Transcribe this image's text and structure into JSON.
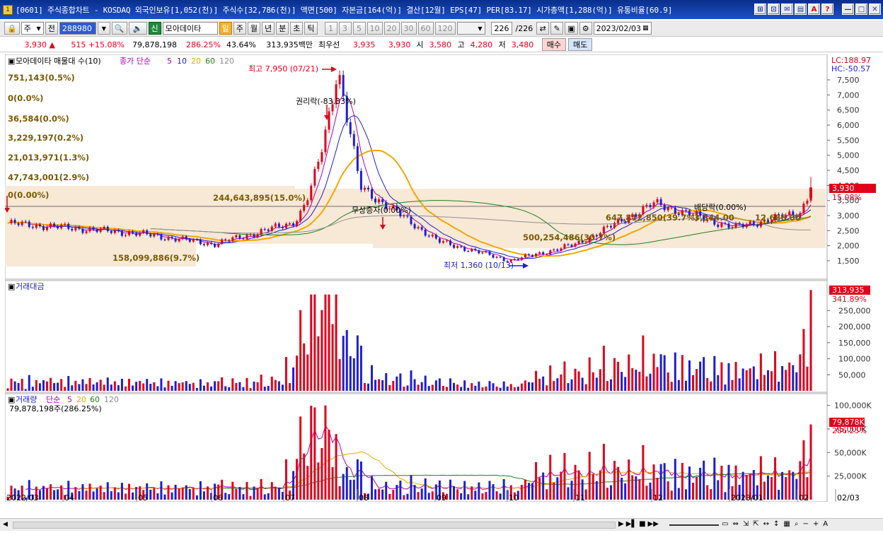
{
  "window": {
    "title": "[0601] 주식종합차트 - KOSDAQ 외국인보유[1,052(천)] 주식수[32,786(천)] 액면[500] 자본금[164(억)] 결산[12월] EPS[47] PER[83.17] 시가총액[1,288(억)] 유통비율[60.9]",
    "buttons": [
      "⊞",
      "⊡",
      "✉",
      "▤",
      "A",
      "?",
      "—",
      "□",
      "✕"
    ]
  },
  "toolbar": {
    "period_select": "주",
    "prev_label": "전",
    "code": "288980",
    "stock_name": "모아데이타",
    "badge_new": "신",
    "periods": [
      "일",
      "주",
      "월",
      "년",
      "분",
      "초",
      "틱"
    ],
    "selected_period": "일",
    "minutes": [
      "1",
      "3",
      "5",
      "10",
      "20",
      "30",
      "60",
      "120"
    ],
    "count": "226",
    "count_total": "/226",
    "date": "2023/02/03"
  },
  "price": {
    "current": "3,930",
    "arrow": "▲",
    "change": "515",
    "change_pct": "+15.08%",
    "volume": "79,878,198",
    "vol_ratio": "286.25%",
    "turnover": "43.64%",
    "trade_amount": "313,935백만",
    "best_ask_label": "최우선",
    "best_ask": "3,935",
    "best_bid": "3,930",
    "open_label": "시",
    "open": "3,580",
    "high_label": "고",
    "high": "4,280",
    "low_label": "저",
    "low": "3,480",
    "buy_label": "매수",
    "sell_label": "매도"
  },
  "panel_price": {
    "legend_title": "모아데이타 매물대 수(10)",
    "ma_label": "종가 단순",
    "ma_periods": [
      "5",
      "10",
      "20",
      "60",
      "120"
    ],
    "ma_colors": [
      "#b000b0",
      "#1e1ed0",
      "#f0a800",
      "#208020",
      "#909090"
    ],
    "lc": "LC:188.97",
    "hc": "HC:-50.57",
    "current_label": "3,930",
    "current_pct": "15.08%",
    "ticks": [
      "7,500",
      "7,000",
      "6,500",
      "6,000",
      "5,500",
      "5,000",
      "4,500",
      "4,000",
      "3,500",
      "3,000",
      "2,500",
      "2,000",
      "1,500"
    ],
    "ann_high": "최고 7,950 (07/21)",
    "ann_low": "최저 1,360 (10/13)",
    "ann_rights": "권리락(-83.33%)",
    "ann_bonus": "무상증자(0.00%)",
    "ann_dividend": "배당락(0.00%)",
    "vp_labels": [
      "751,143(0.5%)",
      "0(0.0%)",
      "36,584(0.0%)",
      "3,229,197(0.2%)",
      "21,013,971(1.3%)",
      "47,743,001(2.9%)",
      "0(0.00%)",
      "244,643,895(15.0%)",
      "158,099,886(9.7%)",
      "500,254,486(30.7%)",
      "647,812,850(39.7%)",
      "3,344.00",
      "12,686.00"
    ]
  },
  "panel_amount": {
    "title": "거래대금",
    "ticks": [
      "250,000",
      "200,000",
      "150,000",
      "100,000",
      "50,000"
    ],
    "current_label": "313,935",
    "current_pct": "341.89%"
  },
  "panel_volume": {
    "title": "거래량",
    "ma_label": "단순",
    "ma_periods": [
      "5",
      "20",
      "60",
      "120"
    ],
    "summary": "79,878,198주(286.25%)",
    "ticks": [
      "100,000K",
      "75,000K",
      "50,000K",
      "25,000K"
    ],
    "current_label": "79,878K",
    "current_pct": "286.25%"
  },
  "x_axis": [
    "2022/03",
    "04",
    "05",
    "06",
    "07",
    "08",
    "09",
    "10",
    "11",
    "12",
    "2023/01",
    "02",
    "02/03"
  ],
  "chart_data": {
    "type": "candlestick",
    "title": "모아데이타 (288980) 일봉",
    "y_ticks": [
      1500,
      2000,
      2500,
      3000,
      3500,
      4000,
      4500,
      5000,
      5500,
      6000,
      6500,
      7000,
      7500
    ],
    "high_point": {
      "value": 7950,
      "date": "07/21"
    },
    "low_point": {
      "value": 1360,
      "date": "10/13"
    },
    "close_path": [
      {
        "m": "2022/03",
        "v": 2750
      },
      {
        "m": "04",
        "v": 2600
      },
      {
        "m": "05",
        "v": 2400
      },
      {
        "m": "06",
        "v": 2050
      },
      {
        "m": "07",
        "v": 2700
      },
      {
        "m": "07/21",
        "v": 7950
      },
      {
        "m": "08",
        "v": 3950
      },
      {
        "m": "09",
        "v": 2150
      },
      {
        "m": "10",
        "v": 1500
      },
      {
        "m": "11",
        "v": 2050
      },
      {
        "m": "12",
        "v": 3400
      },
      {
        "m": "2023/01",
        "v": 2600
      },
      {
        "m": "02",
        "v": 3100
      },
      {
        "m": "02/03",
        "v": 3930
      }
    ],
    "last": {
      "close": 3930,
      "open": 3580,
      "high": 4280,
      "low": 3480,
      "volume_k": 79878,
      "amount_m": 313935
    }
  }
}
